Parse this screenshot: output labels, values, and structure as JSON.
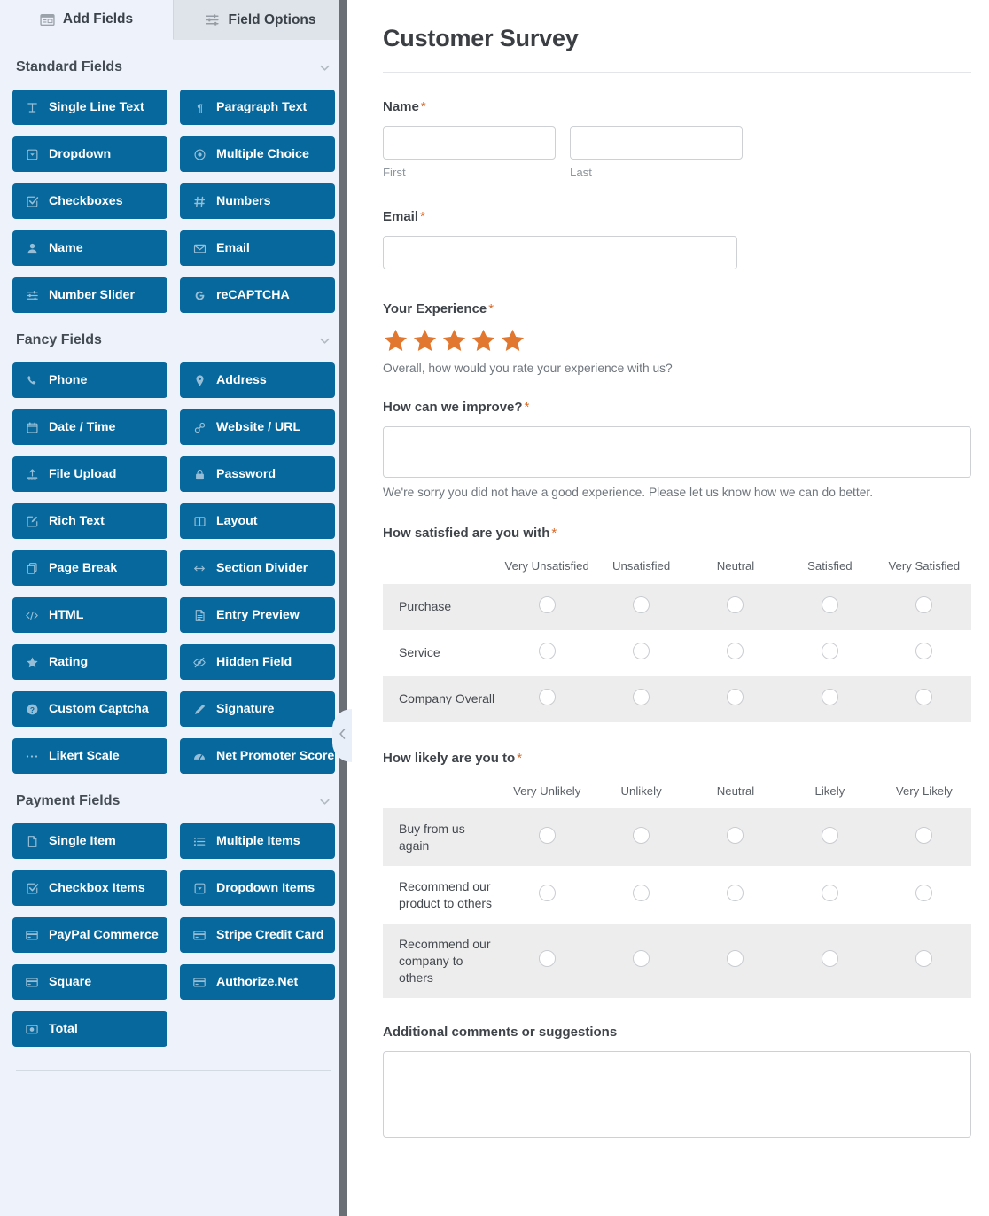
{
  "sidebar": {
    "tabs": [
      {
        "label": "Add Fields",
        "icon": "add-fields-icon",
        "active": true
      },
      {
        "label": "Field Options",
        "icon": "sliders-icon",
        "active": false
      }
    ],
    "sections": [
      {
        "title": "Standard Fields",
        "fields": [
          {
            "label": "Single Line Text",
            "icon": "text-cursor-icon"
          },
          {
            "label": "Paragraph Text",
            "icon": "pilcrow-icon"
          },
          {
            "label": "Dropdown",
            "icon": "dropdown-caret-icon"
          },
          {
            "label": "Multiple Choice",
            "icon": "radio-dot-icon"
          },
          {
            "label": "Checkboxes",
            "icon": "checkbox-check-icon"
          },
          {
            "label": "Numbers",
            "icon": "hash-icon"
          },
          {
            "label": "Name",
            "icon": "person-icon"
          },
          {
            "label": "Email",
            "icon": "envelope-icon"
          },
          {
            "label": "Number Slider",
            "icon": "slider-icon"
          },
          {
            "label": "reCAPTCHA",
            "icon": "google-g-icon"
          }
        ]
      },
      {
        "title": "Fancy Fields",
        "fields": [
          {
            "label": "Phone",
            "icon": "phone-icon"
          },
          {
            "label": "Address",
            "icon": "map-pin-icon"
          },
          {
            "label": "Date / Time",
            "icon": "calendar-icon"
          },
          {
            "label": "Website / URL",
            "icon": "link-icon"
          },
          {
            "label": "File Upload",
            "icon": "upload-icon"
          },
          {
            "label": "Password",
            "icon": "lock-icon"
          },
          {
            "label": "Rich Text",
            "icon": "pencil-square-icon"
          },
          {
            "label": "Layout",
            "icon": "columns-icon"
          },
          {
            "label": "Page Break",
            "icon": "pages-icon"
          },
          {
            "label": "Section Divider",
            "icon": "arrows-horizontal-icon"
          },
          {
            "label": "HTML",
            "icon": "code-icon"
          },
          {
            "label": "Entry Preview",
            "icon": "document-icon"
          },
          {
            "label": "Rating",
            "icon": "star-icon"
          },
          {
            "label": "Hidden Field",
            "icon": "eye-slash-icon"
          },
          {
            "label": "Custom Captcha",
            "icon": "question-circle-icon"
          },
          {
            "label": "Signature",
            "icon": "pen-icon"
          },
          {
            "label": "Likert Scale",
            "icon": "dots-icon"
          },
          {
            "label": "Net Promoter Score",
            "icon": "gauge-icon"
          }
        ]
      },
      {
        "title": "Payment Fields",
        "fields": [
          {
            "label": "Single Item",
            "icon": "page-icon"
          },
          {
            "label": "Multiple Items",
            "icon": "list-icon"
          },
          {
            "label": "Checkbox Items",
            "icon": "checkbox-check-icon"
          },
          {
            "label": "Dropdown Items",
            "icon": "dropdown-caret-icon"
          },
          {
            "label": "PayPal Commerce",
            "icon": "credit-card-icon"
          },
          {
            "label": "Stripe Credit Card",
            "icon": "credit-card-icon"
          },
          {
            "label": "Square",
            "icon": "credit-card-icon"
          },
          {
            "label": "Authorize.Net",
            "icon": "credit-card-icon"
          },
          {
            "label": "Total",
            "icon": "total-icon"
          }
        ]
      }
    ],
    "collapse_handle": "chevron-left-icon"
  },
  "preview": {
    "title": "Customer Survey",
    "required_marker": "*",
    "fields": {
      "name": {
        "label": "Name",
        "required": true,
        "first_sub": "First",
        "last_sub": "Last",
        "first_value": "",
        "last_value": ""
      },
      "email": {
        "label": "Email",
        "required": true,
        "value": ""
      },
      "experience": {
        "label": "Your Experience",
        "required": true,
        "stars": 5,
        "star_color": "#e27730",
        "description": "Overall, how would you rate your experience with us?"
      },
      "improve": {
        "label": "How can we improve?",
        "required": true,
        "value": "",
        "description": "We're sorry you did not have a good experience. Please let us know how we can do better."
      },
      "satisfaction": {
        "label": "How satisfied are you with",
        "required": true,
        "columns": [
          "Very Unsatisfied",
          "Unsatisfied",
          "Neutral",
          "Satisfied",
          "Very Satisfied"
        ],
        "rows": [
          "Purchase",
          "Service",
          "Company Overall"
        ]
      },
      "likelihood": {
        "label": "How likely are you to",
        "required": true,
        "columns": [
          "Very Unlikely",
          "Unlikely",
          "Neutral",
          "Likely",
          "Very Likely"
        ],
        "rows": [
          "Buy from us again",
          "Recommend our product to others",
          "Recommend our company to others"
        ]
      },
      "comments": {
        "label": "Additional comments or suggestions",
        "required": false,
        "value": ""
      }
    }
  },
  "colors": {
    "field_button_blue": "#06689c",
    "panel_background": "#eef3fb",
    "tab_inactive": "#dfe4ea",
    "accent_orange": "#d96a28",
    "likert_alt_row": "#ededed"
  }
}
